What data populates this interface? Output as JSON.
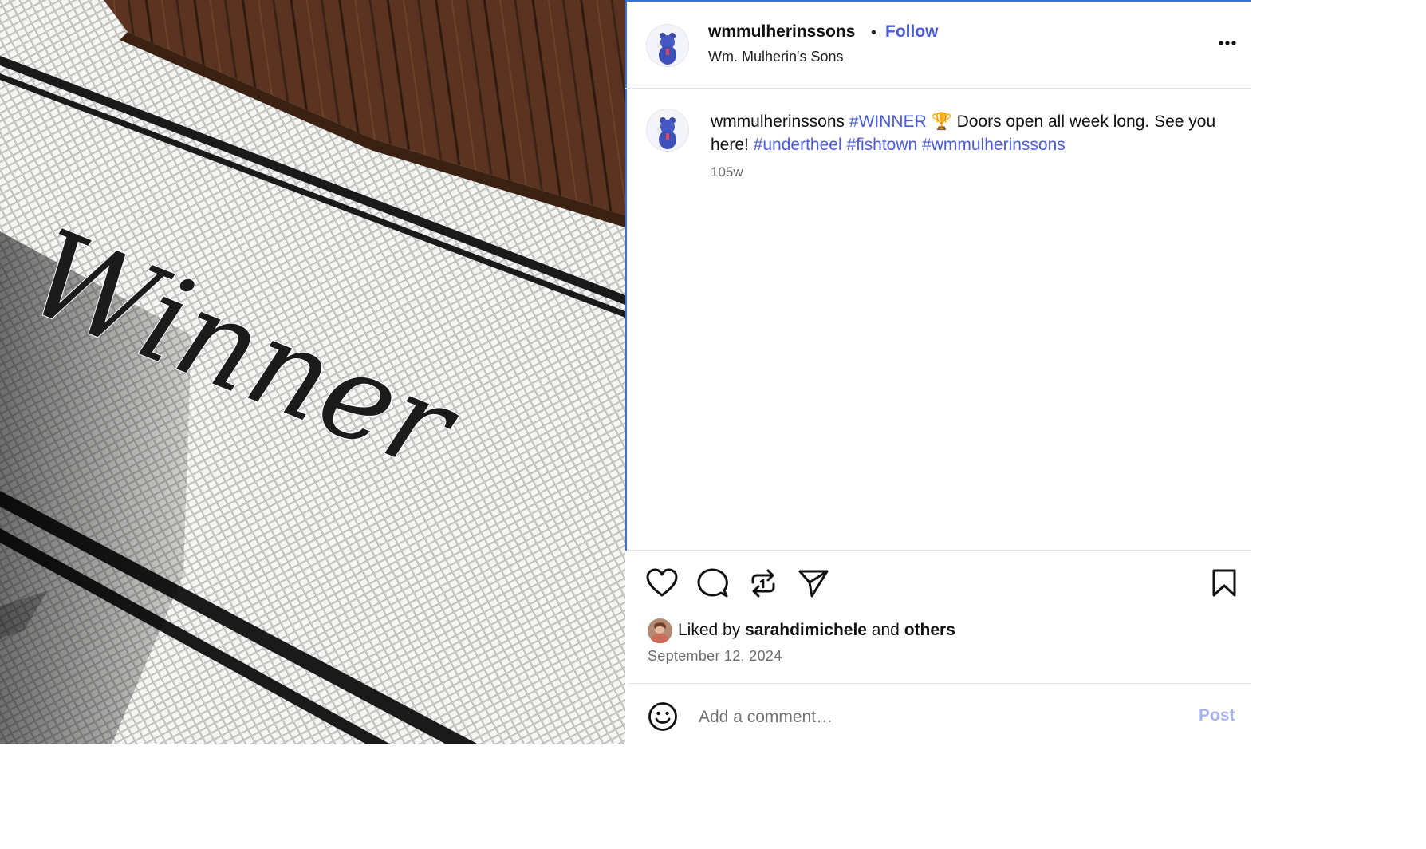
{
  "photo": {
    "mosaic_word": "Winner"
  },
  "post": {
    "username": "wmmulherinssons",
    "separator": "•",
    "follow_label": "Follow",
    "display_name": "Wm. Mulherin's Sons",
    "caption": {
      "username": "wmmulherinssons",
      "tag_winner": "#WINNER",
      "trophy": "🏆",
      "text": " Doors open all week long. See you here! ",
      "tag_1": "#undertheel",
      "tag_2": "#fishtown",
      "tag_3": "#wmmulherinssons"
    },
    "age": "105w",
    "likes": {
      "prefix": "Liked by ",
      "liker": "sarahdimichele",
      "middle": " and ",
      "others": "others"
    },
    "date": "September 12, 2024",
    "comment_placeholder": "Add a comment…",
    "post_label": "Post"
  },
  "icons": {
    "more": "more-horizontal-icon",
    "like": "heart-icon",
    "comment": "speech-bubble-icon",
    "repost": "repost-icon",
    "share": "paper-plane-icon",
    "save": "bookmark-icon",
    "emoji": "smiley-icon"
  },
  "colors": {
    "link": "#4a5bdc",
    "post_button_disabled": "#a7b3f0",
    "muted_text": "#6b6b6b",
    "focus_frame": "#3b6fd8"
  }
}
